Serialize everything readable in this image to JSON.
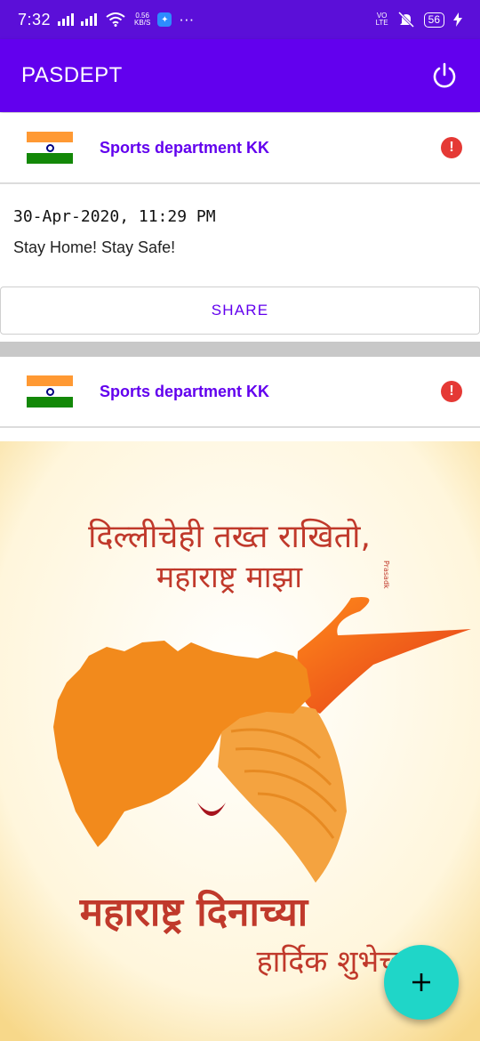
{
  "status_bar": {
    "time": "7:32",
    "net_speed_top": "0.56",
    "net_speed_bottom": "KB/S",
    "more": "···",
    "volte_top": "VO",
    "volte_bottom": "LTE",
    "battery": "56"
  },
  "app_bar": {
    "title": "PASDEPT",
    "power_icon": "power-icon"
  },
  "posts": [
    {
      "author": "Sports department KK",
      "alert_glyph": "!",
      "timestamp": "30-Apr-2020, 11:29 PM",
      "message": "Stay Home! Stay Safe!",
      "share_label": "SHARE"
    },
    {
      "author": "Sports department KK",
      "alert_glyph": "!",
      "image": {
        "line1": "दिल्लीचेही तख्त राखितो,",
        "line2": "महाराष्ट्र माझा",
        "line3": "महाराष्ट्र दिनाच्या",
        "line4": "हार्दिक शुभेच्छा",
        "watermark": "Prasadk"
      }
    }
  ],
  "fab": {
    "label": "+"
  },
  "colors": {
    "primary": "#6200ee",
    "status_bar": "#5b0fd8",
    "fab": "#1fd6c8",
    "alert": "#e53935"
  }
}
